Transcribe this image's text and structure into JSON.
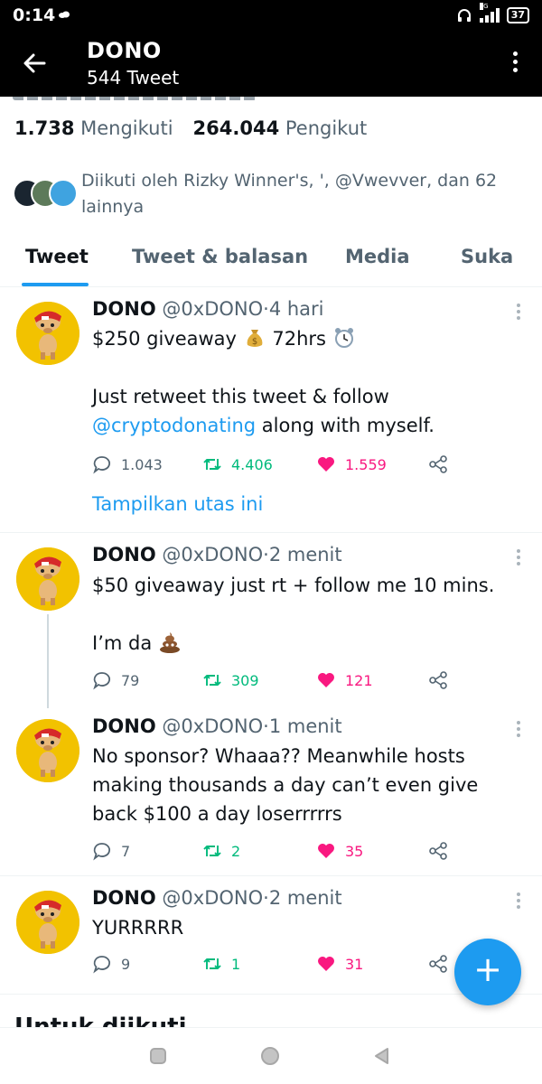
{
  "status_bar": {
    "time": "0:14",
    "network": "5G",
    "battery": "37"
  },
  "header": {
    "title": "DONO",
    "subtitle": "544 Tweet"
  },
  "profile": {
    "following_count": "1.738",
    "following_label": "Mengikuti",
    "followers_count": "264.044",
    "followers_label": "Pengikut",
    "followed_by": "Diikuti oleh Rizky Winner's, ', @Vwevver, dan 62 lainnya"
  },
  "tabs": [
    {
      "label": "Tweet",
      "active": true
    },
    {
      "label": "Tweet & balasan",
      "active": false
    },
    {
      "label": "Media",
      "active": false
    },
    {
      "label": "Suka",
      "active": false
    }
  ],
  "tweets": [
    {
      "name": "DONO",
      "handle": "@0xDONO",
      "dot": "·",
      "time": "4 hari",
      "line1": "$250 giveaway",
      "line1b": "72hrs",
      "line2": "Just retweet this tweet & follow",
      "mention": "@cryptodonating",
      "line3": " along with myself.",
      "replies": "1.043",
      "retweets": "4.406",
      "likes": "1.559",
      "show_thread": "Tampilkan utas ini"
    },
    {
      "name": "DONO",
      "handle": "@0xDONO",
      "dot": "·",
      "time": "2 menit",
      "line1": "$50 giveaway just rt + follow me 10 mins.",
      "line2": "I’m da",
      "replies": "79",
      "retweets": "309",
      "likes": "121"
    },
    {
      "name": "DONO",
      "handle": "@0xDONO",
      "dot": "·",
      "time": "1 menit",
      "line1": "No sponsor? Whaaa?? Meanwhile hosts",
      "line2": "making thousands a day can’t even give",
      "line3": "back $100 a day loserrrrrs",
      "replies": "7",
      "retweets": "2",
      "likes": "35"
    },
    {
      "name": "DONO",
      "handle": "@0xDONO",
      "dot": "·",
      "time": "2 menit",
      "line1": "YURRRRR",
      "replies": "9",
      "retweets": "1",
      "likes": "31"
    }
  ],
  "compose_button": "+",
  "next_section": "Untuk diikuti",
  "colors": {
    "accent": "#1d9bf0",
    "retweet": "#00ba7c",
    "like": "#f91880",
    "avatar_bg": "#f2c200"
  },
  "icons": [
    "back-arrow-icon",
    "more-vertical-icon",
    "reply-icon",
    "retweet-icon",
    "heart-icon",
    "share-icon",
    "money-bag-emoji",
    "alarm-clock-emoji",
    "poop-emoji",
    "compose-plus-icon"
  ]
}
